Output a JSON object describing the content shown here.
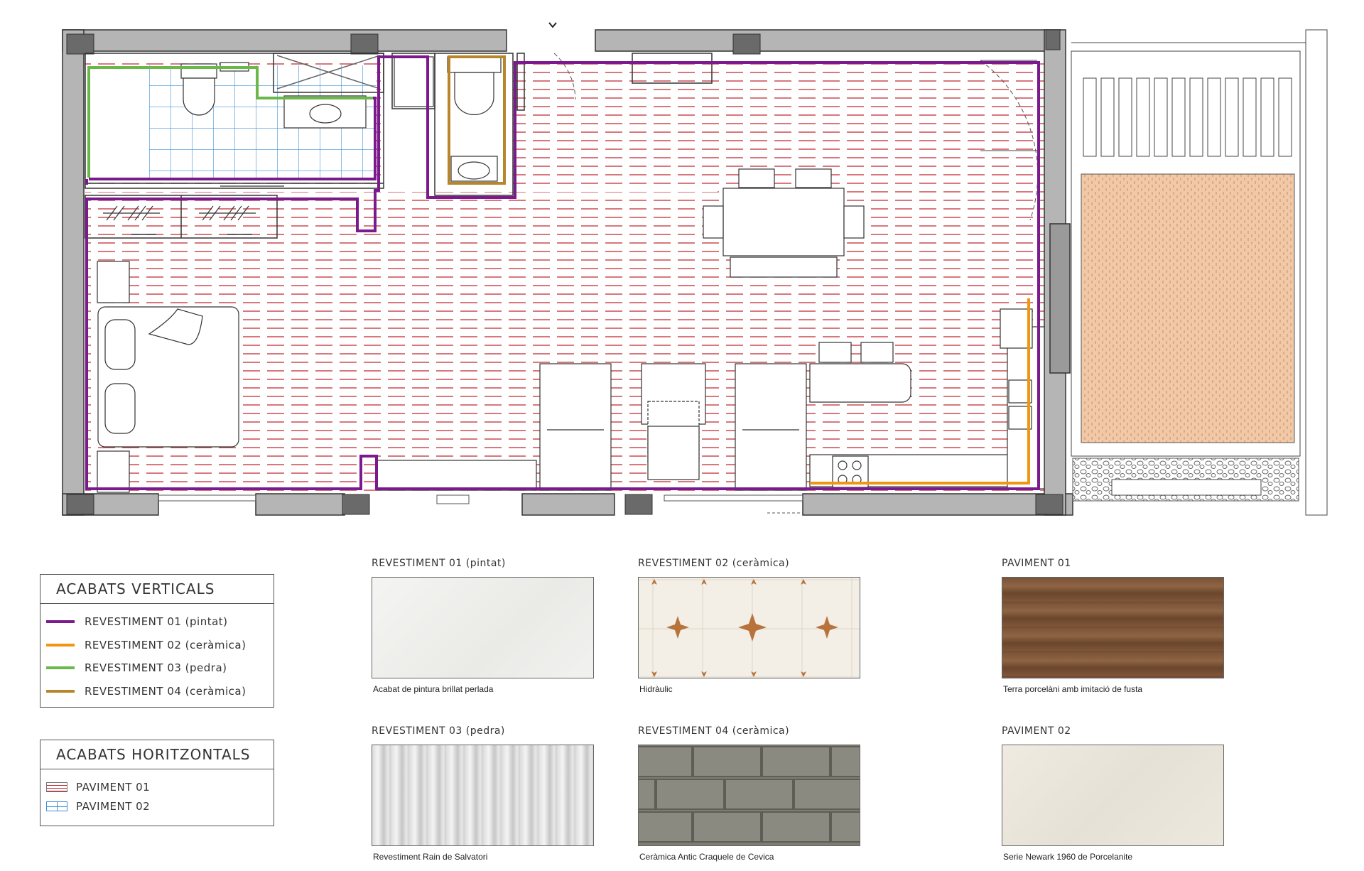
{
  "legend_vertical": {
    "title": "ACABATS VERTICALS",
    "items": [
      {
        "label": "REVESTIMENT 01 (pintat)",
        "color": "#7b1a8c"
      },
      {
        "label": "REVESTIMENT 02 (ceràmica)",
        "color": "#f0960f"
      },
      {
        "label": "REVESTIMENT 03 (pedra)",
        "color": "#6ab84a"
      },
      {
        "label": "REVESTIMENT 04 (ceràmica)",
        "color": "#b8862a"
      }
    ]
  },
  "legend_horizontal": {
    "title": "ACABATS HORITZONTALS",
    "items": [
      {
        "label": "PAVIMENT 01",
        "pattern": "red-dashed"
      },
      {
        "label": "PAVIMENT 02",
        "pattern": "blue-grid"
      }
    ]
  },
  "materials": [
    {
      "heading": "REVESTIMENT 01 (pintat)",
      "caption": "Acabat de pintura brillat perlada"
    },
    {
      "heading": "REVESTIMENT 02 (ceràmica)",
      "caption": "Hidràulic"
    },
    {
      "heading": "PAVIMENT 01",
      "caption": "Terra porcelàni amb imitació de fusta"
    },
    {
      "heading": "REVESTIMENT 03 (pedra)",
      "caption": "Revestiment Rain de Salvatori"
    },
    {
      "heading": "REVESTIMENT 04 (ceràmica)",
      "caption": "Ceràmica Antic Craquele de Cevica"
    },
    {
      "heading": "PAVIMENT 02",
      "caption": "Serie Newark 1960 de Porcelanite"
    }
  ]
}
